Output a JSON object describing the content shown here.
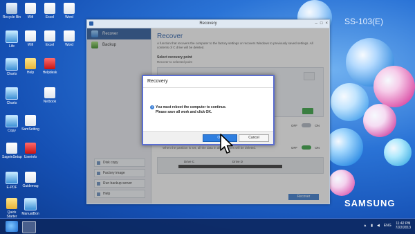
{
  "desktop": {
    "watermark": "SS-103(E)",
    "brand": "SAMSUNG",
    "icons": [
      {
        "label": "Recycle Bin"
      },
      {
        "label": "Wifi"
      },
      {
        "label": "Excel"
      },
      {
        "label": "Word"
      },
      {
        "label": "Life"
      },
      {
        "label": "Wifi"
      },
      {
        "label": "Excel"
      },
      {
        "label": "Word"
      },
      {
        "label": "Charts"
      },
      {
        "label": "Help"
      },
      {
        "label": "Helpdesk"
      },
      {
        "label": "Charts"
      },
      {
        "label": "Netbook"
      },
      {
        "label": "Copy"
      },
      {
        "label": "SamSetting"
      },
      {
        "label": "SageinSetup"
      },
      {
        "label": "Userinfo"
      },
      {
        "label": "E-PDF"
      },
      {
        "label": "Guidemag"
      },
      {
        "label": "Quick Starter"
      },
      {
        "label": "ManualBon"
      }
    ]
  },
  "window": {
    "title": "Recovery",
    "controls": {
      "min": "–",
      "max": "□",
      "close": "×"
    },
    "sidebar": {
      "items": [
        {
          "label": "Recover"
        },
        {
          "label": "Backup"
        }
      ],
      "links": [
        {
          "label": "Disk copy"
        },
        {
          "label": "Factory image"
        },
        {
          "label": "Run backup server"
        },
        {
          "label": "Help"
        }
      ]
    },
    "content": {
      "title": "Recover",
      "description": "A function that recovers the computer to the factory settings or recovers Windows to previously saved settings. All contents of C drive will be deleted.",
      "section1": "Select recovery point",
      "section1_sub": "Recover to selected point",
      "toggle1": {
        "off": "OFF",
        "on": "ON"
      },
      "section2": "Partition settings",
      "section2_sub": "When the partition is set, all the data in all the drives will be deleted.",
      "toggle2": {
        "off": "OFF",
        "on": "ON"
      },
      "progress_label_left": "Drive C",
      "progress_label_right": "Drive D",
      "recover_button": "Recover"
    }
  },
  "dialog": {
    "title": "Recovery",
    "message_line1": "You must reboot the computer to continue.",
    "message_line2": "Please save all work and click OK.",
    "ok": "OK",
    "cancel": "Cancel"
  },
  "taskbar": {
    "tray_lang": "ENG",
    "time": "11:42 PM",
    "date": "7/22/2013"
  }
}
